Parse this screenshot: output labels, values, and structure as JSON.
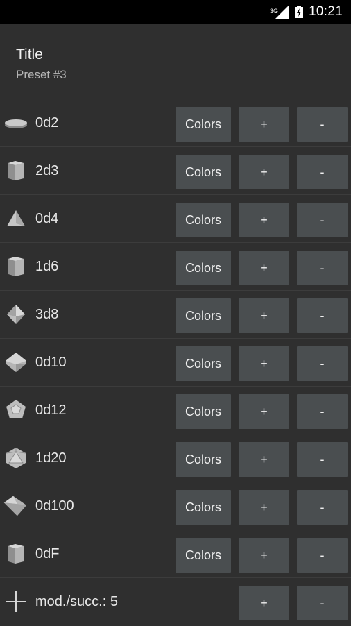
{
  "status_bar": {
    "network": "3G",
    "time": "10:21"
  },
  "header": {
    "title": "Title",
    "subtitle": "Preset #3"
  },
  "dice": [
    {
      "label": "0d2",
      "icon": "d2-icon"
    },
    {
      "label": "2d3",
      "icon": "d3-icon"
    },
    {
      "label": "0d4",
      "icon": "d4-icon"
    },
    {
      "label": "1d6",
      "icon": "d6-icon"
    },
    {
      "label": "3d8",
      "icon": "d8-icon"
    },
    {
      "label": "0d10",
      "icon": "d10-icon"
    },
    {
      "label": "0d12",
      "icon": "d12-icon"
    },
    {
      "label": "1d20",
      "icon": "d20-icon"
    },
    {
      "label": "0d100",
      "icon": "d100-icon"
    },
    {
      "label": "0dF",
      "icon": "dF-icon"
    }
  ],
  "buttons": {
    "colors": "Colors",
    "plus": "+",
    "minus": "-"
  },
  "modifier": {
    "label": "mod./succ.: 5",
    "icon": "plus-icon"
  }
}
